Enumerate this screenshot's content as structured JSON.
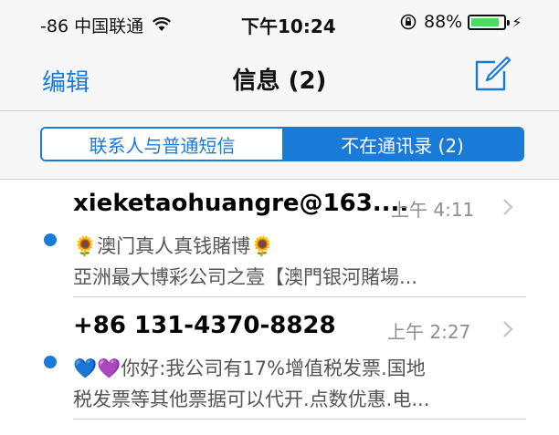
{
  "status_bar": {
    "carrier": "-86 中国联通",
    "time": "下午10:24",
    "battery": "88%"
  },
  "nav": {
    "edit_label": "编辑",
    "title": "信息 (2)"
  },
  "segments": [
    {
      "label": "联系人与普通短信",
      "selected": false
    },
    {
      "label": "不在通讯录 (2)",
      "selected": true
    }
  ],
  "messages": [
    {
      "sender": "xieketaohuangre@163....",
      "time": "上午 4:11",
      "line1": "🌻澳门真人真钱賭博🌻",
      "line2": "亞洲最大博彩公司之壹【澳門银河賭場...",
      "unread": true
    },
    {
      "sender": "+86 131-4370-8828",
      "time": "上午 2:27",
      "line1": "💙💜你好:我公司有17%增值税发票.国地",
      "line2": "税发票等其他票据可以代开.点数优惠.电...",
      "unread": true
    }
  ],
  "colors": {
    "accent": "#1a7ad7",
    "battery": "#4cd964",
    "secondary_text": "#8e8e93"
  }
}
